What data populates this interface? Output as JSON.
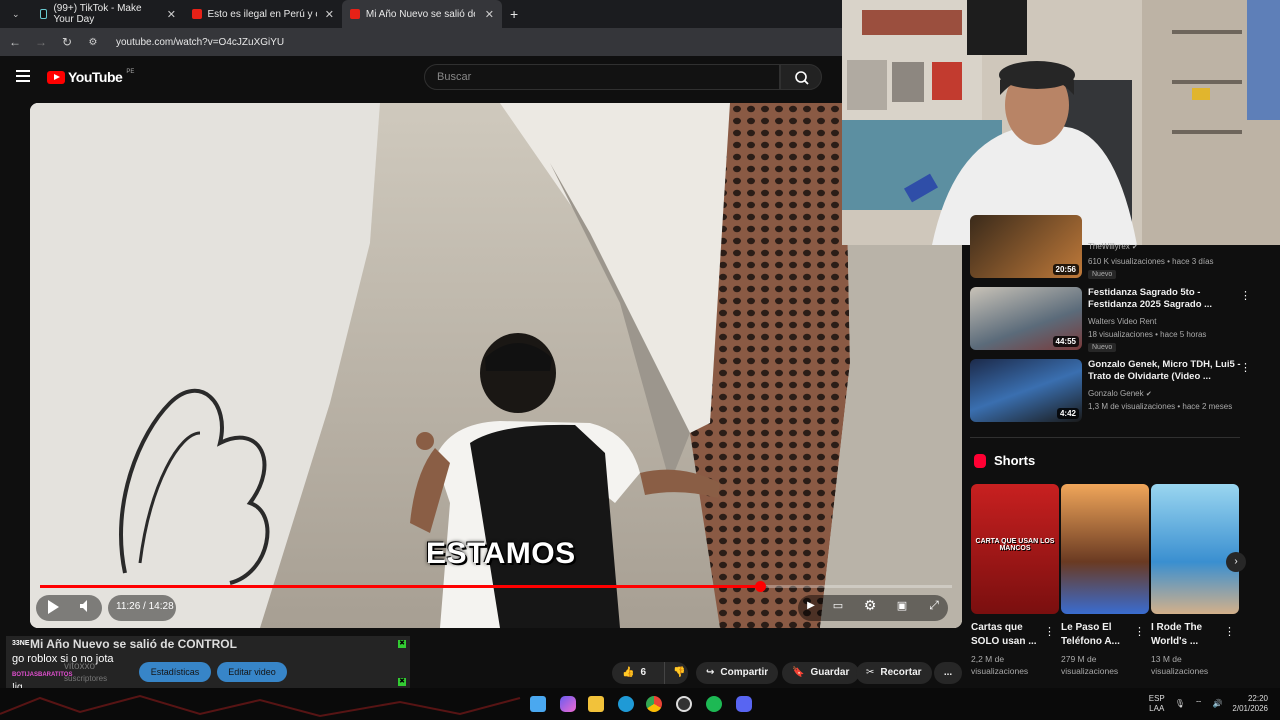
{
  "browser": {
    "tabs": [
      {
        "label": "(99+) TikTok - Make Your Day"
      },
      {
        "label": "Esto es ilegal en Perú y casi nad"
      },
      {
        "label": "Mi Año Nuevo se salió de CON"
      }
    ],
    "url": "youtube.com/watch?v=O4cJZuXGiYU"
  },
  "youtube": {
    "logo_word": "YouTube",
    "country": "PE",
    "search_placeholder": "Buscar"
  },
  "player": {
    "caption": "ESTAMOS",
    "current_time": "11:26",
    "duration": "14:28",
    "time_display": "11:26 / 14:28",
    "progress_fraction": 0.79
  },
  "below_video": {
    "overlay_title": "Mi Año Nuevo se salió de CONTROL",
    "chat_line1": "go roblox si o no jota",
    "chat_name": "BOTIJASBARATITOS",
    "chat_line2": "!ig",
    "chat_user_fragment": "33NE",
    "channel_fragment": "vitoxxo",
    "subs_fragment": "suscriptores",
    "chips": [
      "Estadísticas",
      "Editar video"
    ],
    "likes": "6",
    "actions": {
      "share": "Compartir",
      "save": "Guardar",
      "clip": "Recortar",
      "more": "..."
    }
  },
  "sidebar": {
    "videos": [
      {
        "title": "",
        "channel": "TheWillyrex",
        "meta": "610 K visualizaciones • hace 3 días",
        "badge": "Nuevo",
        "duration": "20:56"
      },
      {
        "title": "Festidanza Sagrado 5to - Festidanza 2025 Sagrado ...",
        "channel": "Walters Video Rent",
        "meta": "18 visualizaciones • hace 5 horas",
        "badge": "Nuevo",
        "duration": "44:55"
      },
      {
        "title": "Gonzalo Genek, Micro TDH, Lui5 - Trato de Olvidarte (Video ...",
        "channel": "Gonzalo Genek",
        "meta": "1,3 M de visualizaciones • hace 2 meses",
        "badge": "",
        "duration": "4:42"
      }
    ],
    "shorts_label": "Shorts",
    "shorts": [
      {
        "title": "Cartas que SOLO usan ...",
        "views": "2,2 M de visualizaciones",
        "overlay": "CARTA QUE USAN LOS MANCOS"
      },
      {
        "title": "Le Paso El Teléfono A...",
        "views": "279 M de visualizaciones",
        "overlay": ""
      },
      {
        "title": "I Rode The World's ...",
        "views": "13 M de visualizaciones",
        "overlay": ""
      }
    ]
  },
  "taskbar": {
    "lang": "ESP",
    "lang2": "LAA",
    "time": "22:20",
    "date": "2/01/2026"
  },
  "colors": {
    "yt_red": "#ff0000",
    "bg": "#0f0f0f",
    "chip_blue": "#3ea6ff"
  }
}
